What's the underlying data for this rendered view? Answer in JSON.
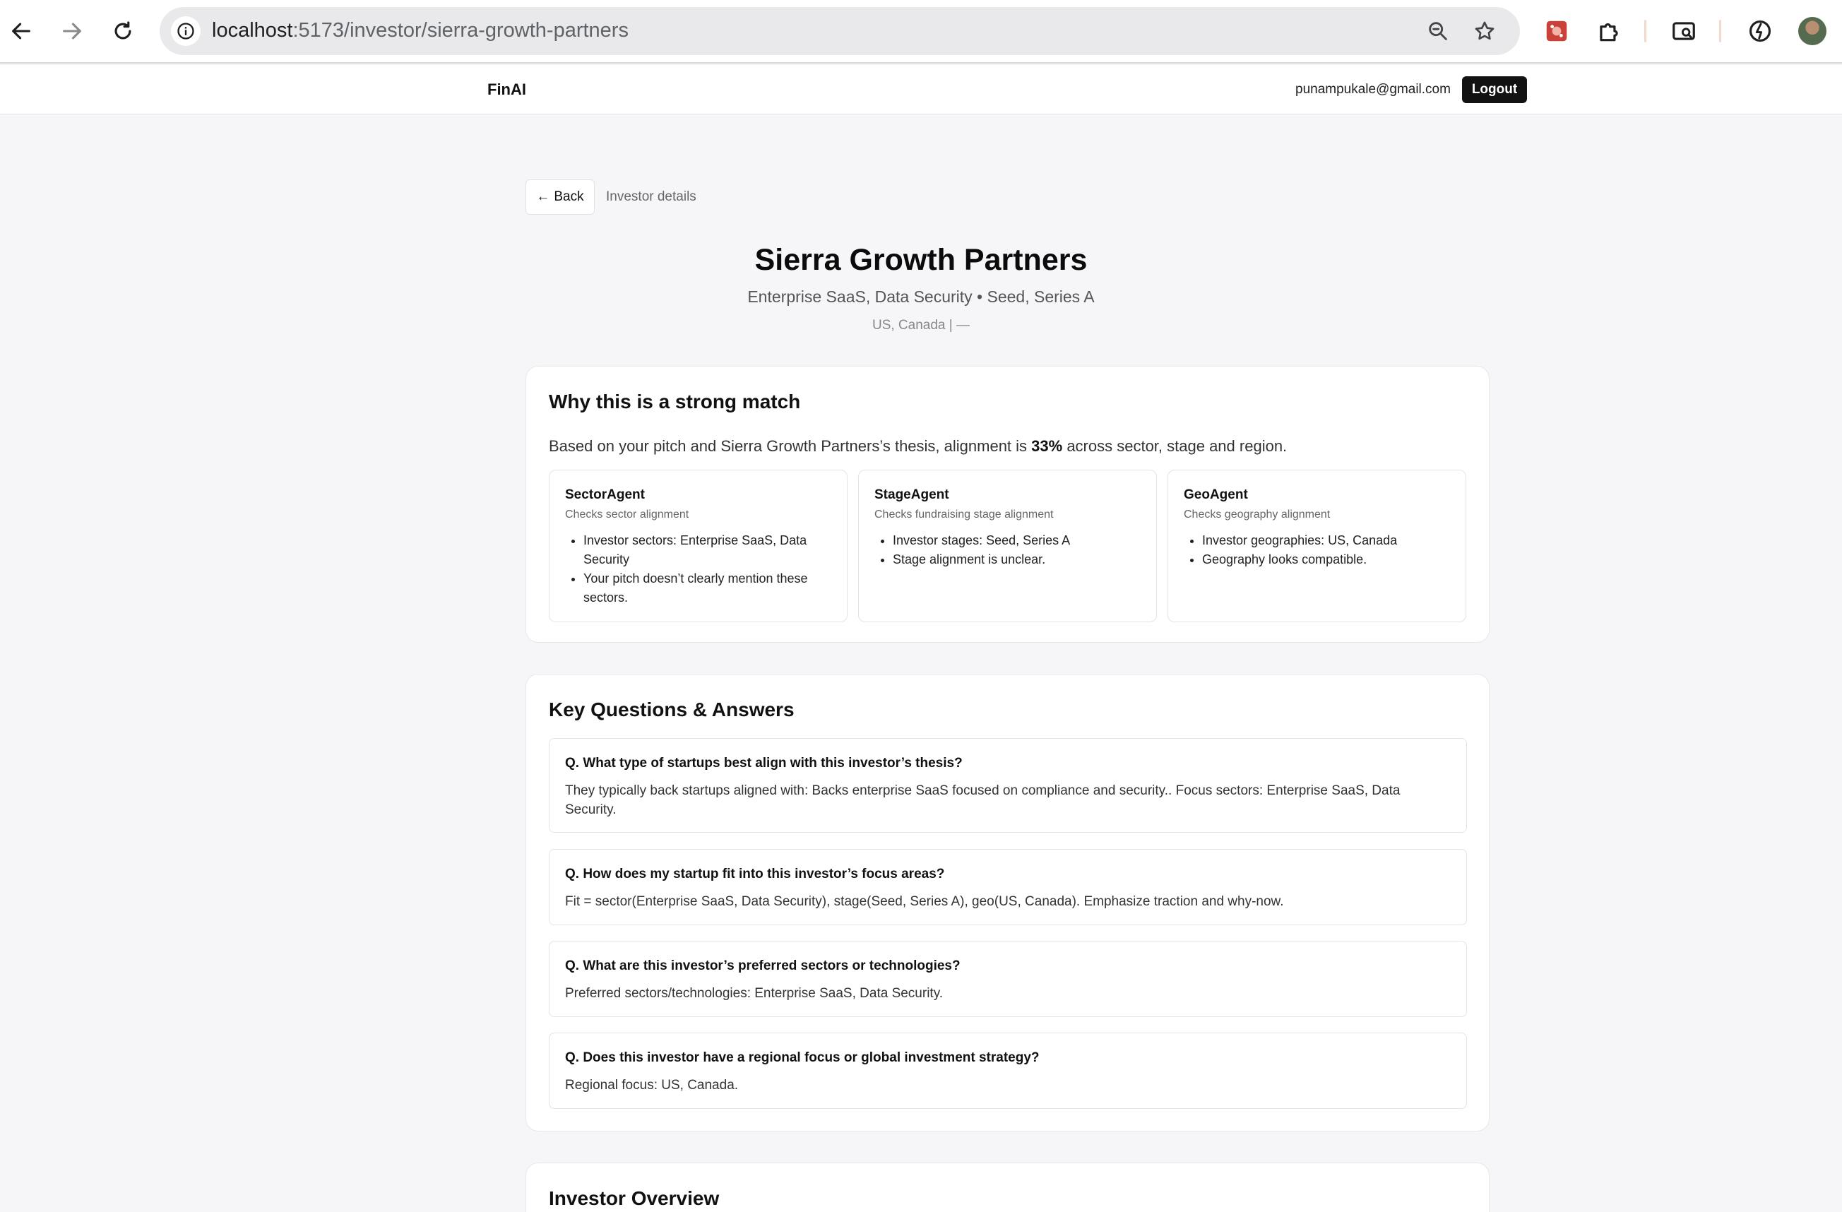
{
  "browser": {
    "url_host": "localhost",
    "url_path": ":5173/investor/sierra-growth-partners"
  },
  "app": {
    "brand": "FinAI",
    "user_email": "punampukale@gmail.com",
    "logout_label": "Logout"
  },
  "header": {
    "back_label": "Back",
    "breadcrumb": "Investor details",
    "investor_name": "Sierra Growth Partners",
    "subtitle": "Enterprise SaaS, Data Security • Seed, Series A",
    "location": "US, Canada | —"
  },
  "match": {
    "title": "Why this is a strong match",
    "text_before": "Based on your pitch and Sierra Growth Partners’s thesis, alignment is ",
    "percent": "33%",
    "text_after": " across sector, stage and region.",
    "agents": [
      {
        "name": "SectorAgent",
        "desc": "Checks sector alignment",
        "points": [
          "Investor sectors: Enterprise SaaS, Data Security",
          "Your pitch doesn’t clearly mention these sectors."
        ]
      },
      {
        "name": "StageAgent",
        "desc": "Checks fundraising stage alignment",
        "points": [
          "Investor stages: Seed, Series A",
          "Stage alignment is unclear."
        ]
      },
      {
        "name": "GeoAgent",
        "desc": "Checks geography alignment",
        "points": [
          "Investor geographies: US, Canada",
          "Geography looks compatible."
        ]
      }
    ]
  },
  "qa": {
    "title": "Key Questions & Answers",
    "items": [
      {
        "q": "Q. What type of startups best align with this investor’s thesis?",
        "a": "They typically back startups aligned with: Backs enterprise SaaS focused on compliance and security.. Focus sectors: Enterprise SaaS, Data Security."
      },
      {
        "q": "Q. How does my startup fit into this investor’s focus areas?",
        "a": "Fit = sector(Enterprise SaaS, Data Security), stage(Seed, Series A), geo(US, Canada). Emphasize traction and why-now."
      },
      {
        "q": "Q. What are this investor’s preferred sectors or technologies?",
        "a": "Preferred sectors/technologies: Enterprise SaaS, Data Security."
      },
      {
        "q": "Q. Does this investor have a regional focus or global investment strategy?",
        "a": "Regional focus: US, Canada."
      }
    ]
  },
  "overview": {
    "title": "Investor Overview"
  },
  "icons": {
    "back_arrow": "arrow-left-icon",
    "forward_arrow": "arrow-right-icon",
    "reload": "reload-icon",
    "site_info": "info-icon",
    "zoom": "zoom-icon",
    "bookmark": "star-icon"
  },
  "colors": {
    "page_bg": "#f6f6f9",
    "logout_bg": "#121212"
  }
}
